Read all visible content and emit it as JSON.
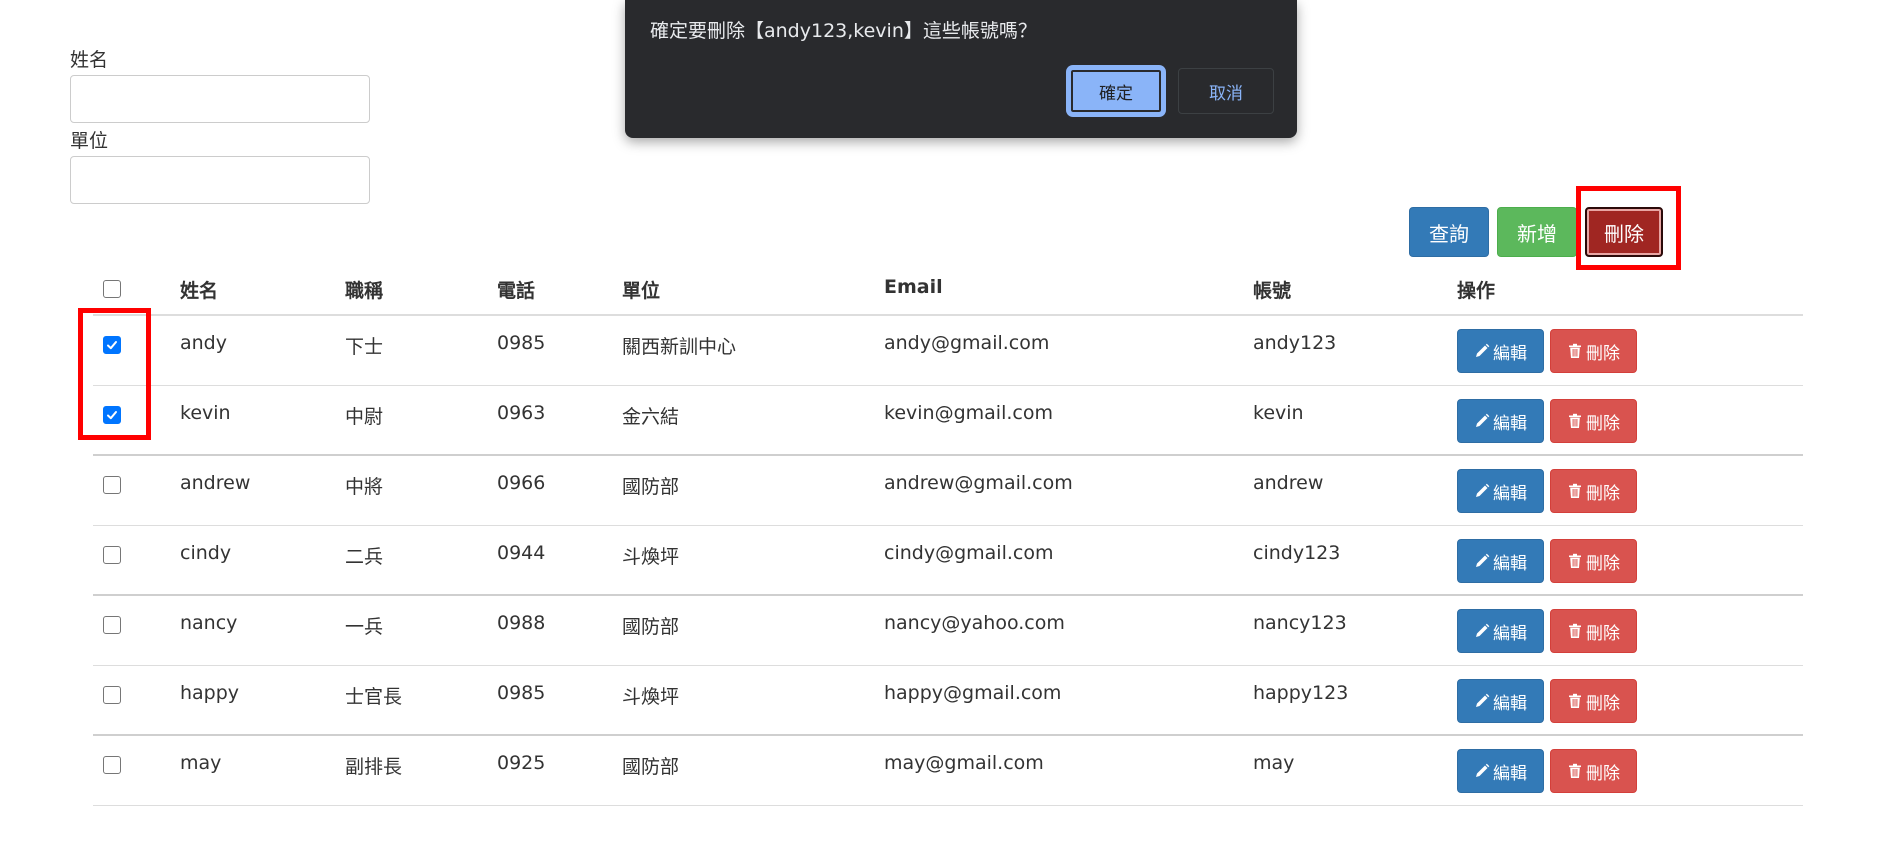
{
  "form": {
    "name_label": "姓名",
    "name_value": "",
    "unit_label": "單位",
    "unit_value": ""
  },
  "toolbar": {
    "query_label": "查詢",
    "add_label": "新增",
    "delete_label": "刪除"
  },
  "table": {
    "headers": {
      "name": "姓名",
      "title": "職稱",
      "phone": "電話",
      "unit": "單位",
      "email": "Email",
      "account": "帳號",
      "ops": "操作"
    },
    "edit_label": "編輯",
    "delete_label": "刪除",
    "rows": [
      {
        "checked": true,
        "name": "andy",
        "title": "下士",
        "phone": "0985",
        "unit": "關西新訓中心",
        "email": "andy@gmail.com",
        "account": "andy123"
      },
      {
        "checked": true,
        "name": "kevin",
        "title": "中尉",
        "phone": "0963",
        "unit": "金六結",
        "email": "kevin@gmail.com",
        "account": "kevin"
      },
      {
        "checked": false,
        "name": "andrew",
        "title": "中將",
        "phone": "0966",
        "unit": "國防部",
        "email": "andrew@gmail.com",
        "account": "andrew"
      },
      {
        "checked": false,
        "name": "cindy",
        "title": "二兵",
        "phone": "0944",
        "unit": "斗煥坪",
        "email": "cindy@gmail.com",
        "account": "cindy123"
      },
      {
        "checked": false,
        "name": "nancy",
        "title": "一兵",
        "phone": "0988",
        "unit": "國防部",
        "email": "nancy@yahoo.com",
        "account": "nancy123"
      },
      {
        "checked": false,
        "name": "happy",
        "title": "士官長",
        "phone": "0985",
        "unit": "斗煥坪",
        "email": "happy@gmail.com",
        "account": "happy123"
      },
      {
        "checked": false,
        "name": "may",
        "title": "副排長",
        "phone": "0925",
        "unit": "國防部",
        "email": "may@gmail.com",
        "account": "may"
      }
    ]
  },
  "dialog": {
    "message": "確定要刪除【andy123,kevin】這些帳號嗎？",
    "ok_label": "確定",
    "cancel_label": "取消"
  },
  "icons": {
    "edit": "pencil-icon",
    "delete": "trash-icon",
    "check": "check-icon"
  },
  "colors": {
    "primary": "#337ab7",
    "success": "#5cb85c",
    "danger": "#d9534f",
    "danger_active": "#a02622",
    "highlight": "#ff0000",
    "dialog_bg": "#292a2d",
    "dialog_accent": "#8ab4f8",
    "checkbox_checked": "#0075ff"
  }
}
